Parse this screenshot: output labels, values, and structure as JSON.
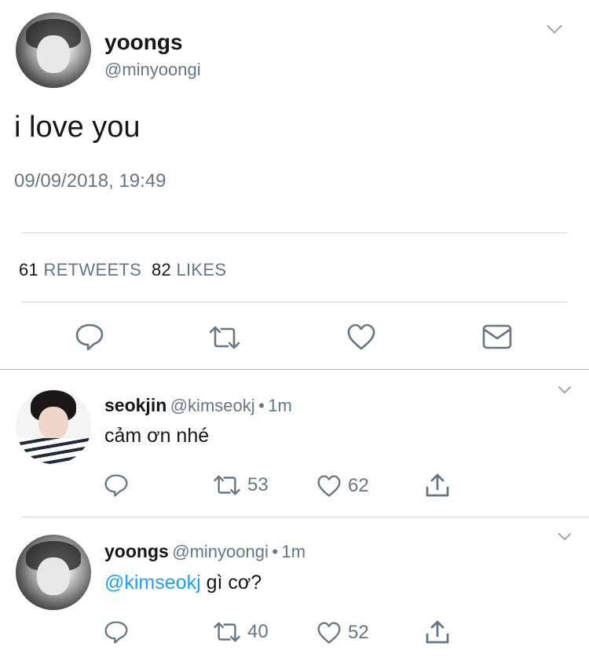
{
  "main_tweet": {
    "name": "yoongs",
    "handle": "@minyoongi",
    "text": "i love you",
    "timestamp": "09/09/2018, 19:49",
    "retweets_count": "61",
    "retweets_label": "RETWEETS",
    "likes_count": "82",
    "likes_label": "LIKES",
    "actions": [
      "reply-icon",
      "retweet-icon",
      "heart-icon",
      "mail-icon"
    ]
  },
  "replies": [
    {
      "name": "seokjin",
      "handle": "@kimseokj",
      "separator": "•",
      "time": "1m",
      "text": "cảm ơn nhé",
      "retweets": "53",
      "likes": "62"
    },
    {
      "name": "yoongs",
      "handle": "@minyoongi",
      "separator": "•",
      "time": "1m",
      "mention": "@kimseokj",
      "text": " gì cơ?",
      "retweets": "40",
      "likes": "52"
    }
  ],
  "colors": {
    "text": "#14171a",
    "secondary": "#657786",
    "link": "#1da1f2",
    "divider": "#ccd6dd",
    "icon": "#657786"
  }
}
